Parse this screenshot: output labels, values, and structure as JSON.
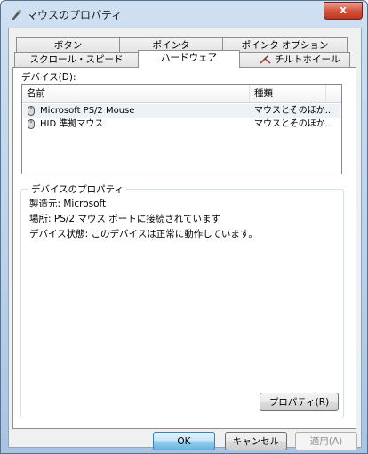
{
  "window": {
    "title": "マウスのプロパティ",
    "close_label": "x"
  },
  "tabs_back": [
    {
      "label": "ボタン"
    },
    {
      "label": "ポインタ"
    },
    {
      "label": "ポインタ オプション"
    }
  ],
  "tabs_front": [
    {
      "label": "スクロール・スピード"
    },
    {
      "label": "ハードウェア"
    },
    {
      "label": "チルトホイール"
    }
  ],
  "devices": {
    "label": "デバイス(D):",
    "columns": [
      "名前",
      "種類"
    ],
    "rows": [
      {
        "name": "Microsoft PS/2 Mouse",
        "type": "マウスとそのほか..."
      },
      {
        "name": "HID 準拠マウス",
        "type": "マウスとそのほか..."
      }
    ]
  },
  "properties": {
    "group_title": "デバイスのプロパティ",
    "manufacturer": "製造元: Microsoft",
    "location": "場所: PS/2 マウス ポートに接続されています",
    "status": "デバイス状態: このデバイスは正常に動作しています。",
    "button": "プロパティ(R)"
  },
  "buttons": {
    "ok": "OK",
    "cancel": "キャンセル",
    "apply": "適用(A)"
  }
}
